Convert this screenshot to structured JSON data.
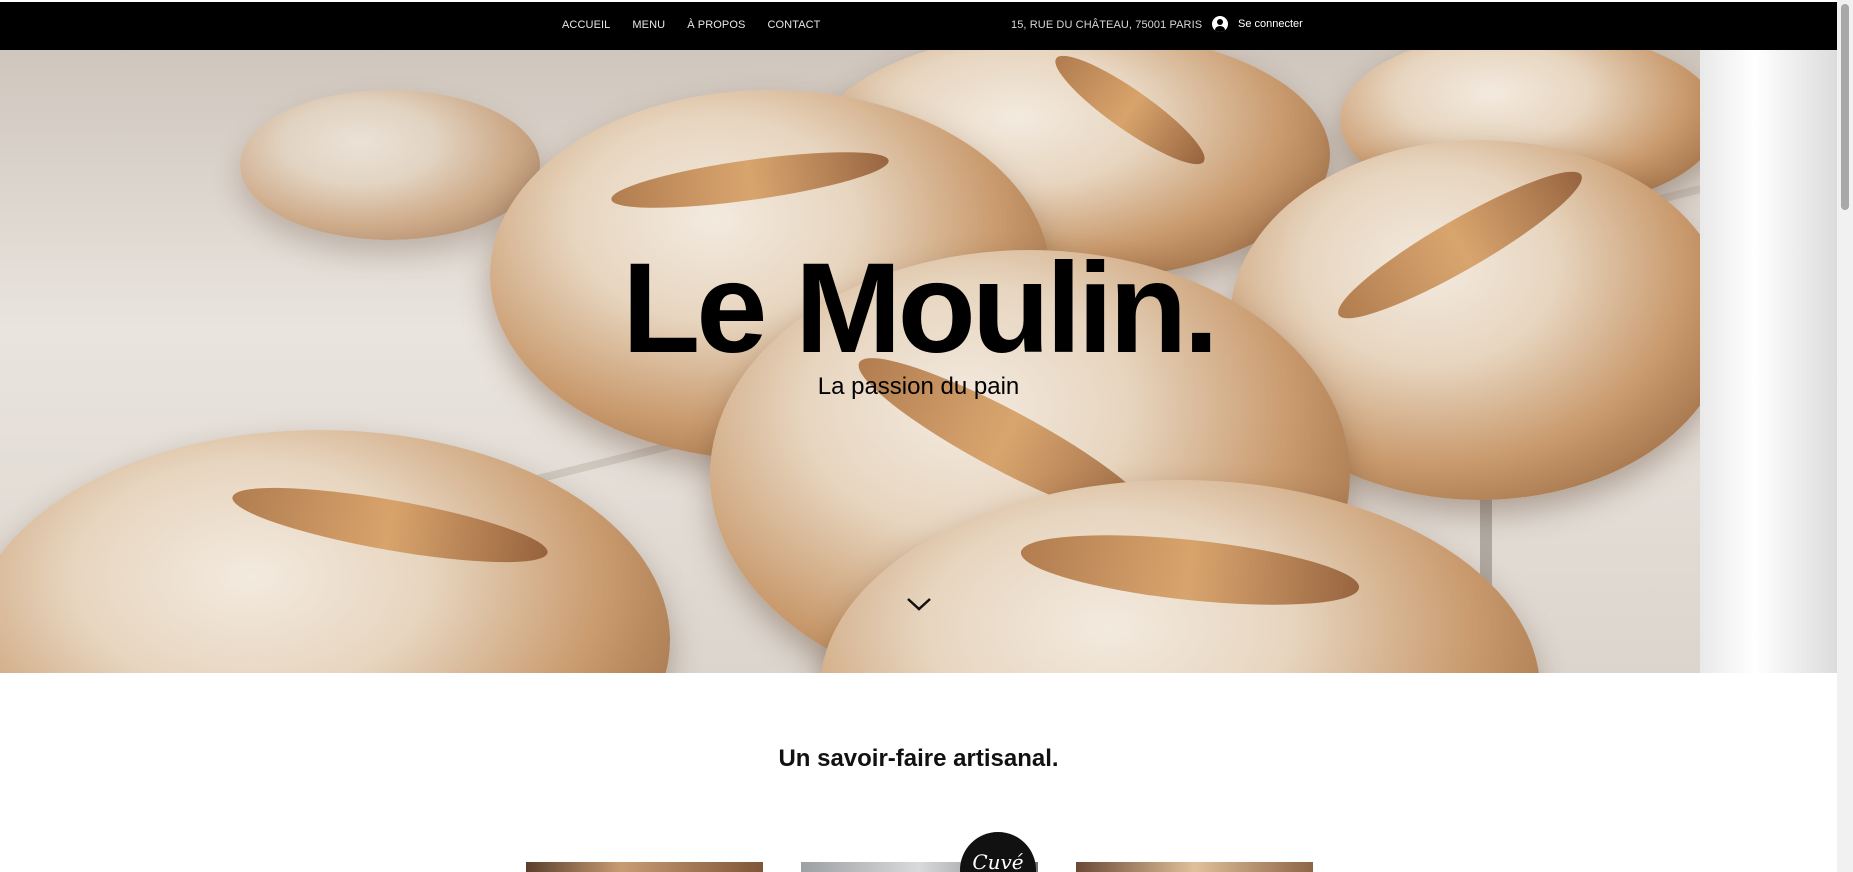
{
  "header": {
    "nav_items": [
      {
        "label": "ACCUEIL"
      },
      {
        "label": "MENU"
      },
      {
        "label": "À PROPOS"
      },
      {
        "label": "CONTACT"
      }
    ],
    "address": "15, RUE DU CHÂTEAU, 75001 PARIS",
    "login_label": "Se connecter",
    "login_icon": "avatar-icon"
  },
  "hero": {
    "title": "Le Moulin.",
    "subtitle": "La passion du pain",
    "scroll_icon": "chevron-down-icon"
  },
  "section": {
    "title": "Un savoir-faire artisanal.",
    "badge_text": "Cuvé"
  },
  "colors": {
    "topbar": "#000000",
    "text": "#000000",
    "background": "#ffffff"
  }
}
